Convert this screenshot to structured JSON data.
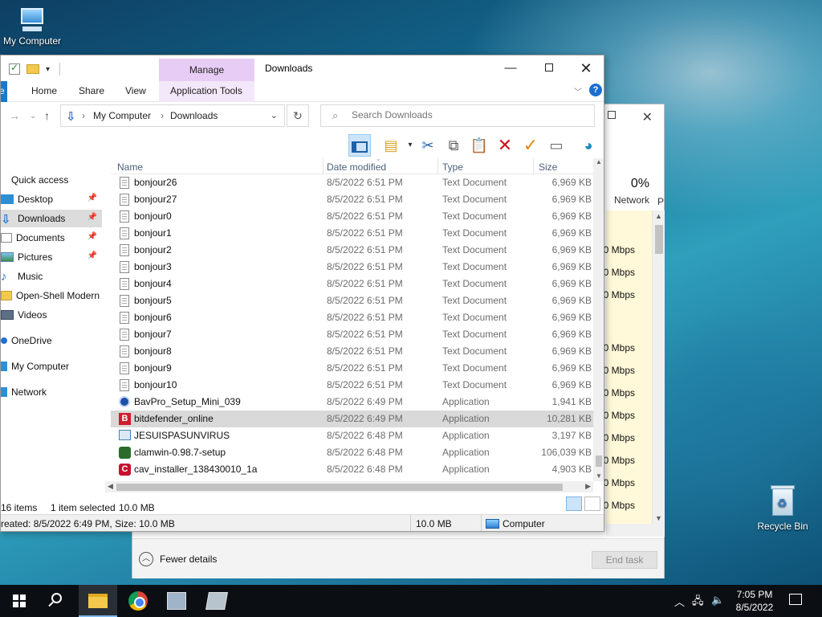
{
  "desktop": {
    "my_computer_label": "My Computer",
    "recycle_bin_label": "Recycle Bin"
  },
  "taskmgr": {
    "network_pct": "0%",
    "network_label": "Network",
    "next_col_label": "P",
    "mbps_rows": [
      "0 Mbps",
      "0 Mbps",
      "0 Mbps",
      "0 Mbps",
      "0 Mbps",
      "0 Mbps",
      "0 Mbps",
      "0 Mbps",
      "0 Mbps",
      "0 Mbps",
      "0 Mbps",
      "0 Mbps"
    ],
    "fewer_details": "Fewer details",
    "end_task": "End task"
  },
  "explorer": {
    "title": "Downloads",
    "manage_tab": "Manage",
    "ribbon_tabs": {
      "file": "e",
      "home": "Home",
      "share": "Share",
      "view": "View",
      "app_tools": "Application Tools"
    },
    "address": {
      "crumb1": "My Computer",
      "crumb2": "Downloads",
      "search_placeholder": "Search Downloads"
    },
    "sidebar": [
      {
        "label": "Quick access",
        "icon": "star-icon"
      },
      {
        "label": "Desktop",
        "icon": "desktop-icon"
      },
      {
        "label": "Downloads",
        "icon": "download-icon"
      },
      {
        "label": "Documents",
        "icon": "documents-icon"
      },
      {
        "label": "Pictures",
        "icon": "pictures-icon"
      },
      {
        "label": "Music",
        "icon": "music-icon"
      },
      {
        "label": "Open-Shell Modern",
        "icon": "folder-icon"
      },
      {
        "label": "Videos",
        "icon": "videos-icon"
      },
      {
        "label": "OneDrive",
        "icon": "cloud-icon"
      },
      {
        "label": "My Computer",
        "icon": "computer-icon"
      },
      {
        "label": "Network",
        "icon": "network-icon"
      }
    ],
    "columns": {
      "name": "Name",
      "date": "Date modified",
      "type": "Type",
      "size": "Size"
    },
    "files": [
      {
        "name": "bonjour26",
        "date": "8/5/2022 6:51 PM",
        "type": "Text Document",
        "size": "6,969 KB",
        "icon": "doc"
      },
      {
        "name": "bonjour27",
        "date": "8/5/2022 6:51 PM",
        "type": "Text Document",
        "size": "6,969 KB",
        "icon": "doc"
      },
      {
        "name": "bonjour0",
        "date": "8/5/2022 6:51 PM",
        "type": "Text Document",
        "size": "6,969 KB",
        "icon": "doc"
      },
      {
        "name": "bonjour1",
        "date": "8/5/2022 6:51 PM",
        "type": "Text Document",
        "size": "6,969 KB",
        "icon": "doc"
      },
      {
        "name": "bonjour2",
        "date": "8/5/2022 6:51 PM",
        "type": "Text Document",
        "size": "6,969 KB",
        "icon": "doc"
      },
      {
        "name": "bonjour3",
        "date": "8/5/2022 6:51 PM",
        "type": "Text Document",
        "size": "6,969 KB",
        "icon": "doc"
      },
      {
        "name": "bonjour4",
        "date": "8/5/2022 6:51 PM",
        "type": "Text Document",
        "size": "6,969 KB",
        "icon": "doc"
      },
      {
        "name": "bonjour5",
        "date": "8/5/2022 6:51 PM",
        "type": "Text Document",
        "size": "6,969 KB",
        "icon": "doc"
      },
      {
        "name": "bonjour6",
        "date": "8/5/2022 6:51 PM",
        "type": "Text Document",
        "size": "6,969 KB",
        "icon": "doc"
      },
      {
        "name": "bonjour7",
        "date": "8/5/2022 6:51 PM",
        "type": "Text Document",
        "size": "6,969 KB",
        "icon": "doc"
      },
      {
        "name": "bonjour8",
        "date": "8/5/2022 6:51 PM",
        "type": "Text Document",
        "size": "6,969 KB",
        "icon": "doc"
      },
      {
        "name": "bonjour9",
        "date": "8/5/2022 6:51 PM",
        "type": "Text Document",
        "size": "6,969 KB",
        "icon": "doc"
      },
      {
        "name": "bonjour10",
        "date": "8/5/2022 6:51 PM",
        "type": "Text Document",
        "size": "6,969 KB",
        "icon": "doc"
      },
      {
        "name": "BavPro_Setup_Mini_039",
        "date": "8/5/2022 6:49 PM",
        "type": "Application",
        "size": "1,941 KB",
        "icon": "bav"
      },
      {
        "name": "bitdefender_online",
        "date": "8/5/2022 6:49 PM",
        "type": "Application",
        "size": "10,281 KB",
        "icon": "bd"
      },
      {
        "name": "JESUISPASUNVIRUS",
        "date": "8/5/2022 6:48 PM",
        "type": "Application",
        "size": "3,197 KB",
        "icon": "jes"
      },
      {
        "name": "clamwin-0.98.7-setup",
        "date": "8/5/2022 6:48 PM",
        "type": "Application",
        "size": "106,039 KB",
        "icon": "clam"
      },
      {
        "name": "cav_installer_138430010_1a",
        "date": "8/5/2022 6:48 PM",
        "type": "Application",
        "size": "4,903 KB",
        "icon": "cav"
      }
    ],
    "selected_file": "bitdefender_online",
    "status": {
      "items": "16 items",
      "selected": "1 item selected",
      "selected_size": "10.0 MB"
    },
    "details": {
      "created": "reated: 8/5/2022 6:49 PM, Size: 10.0 MB",
      "size": "10.0 MB",
      "location": "Computer"
    }
  },
  "taskbar": {
    "time": "7:05 PM",
    "date": "8/5/2022"
  }
}
